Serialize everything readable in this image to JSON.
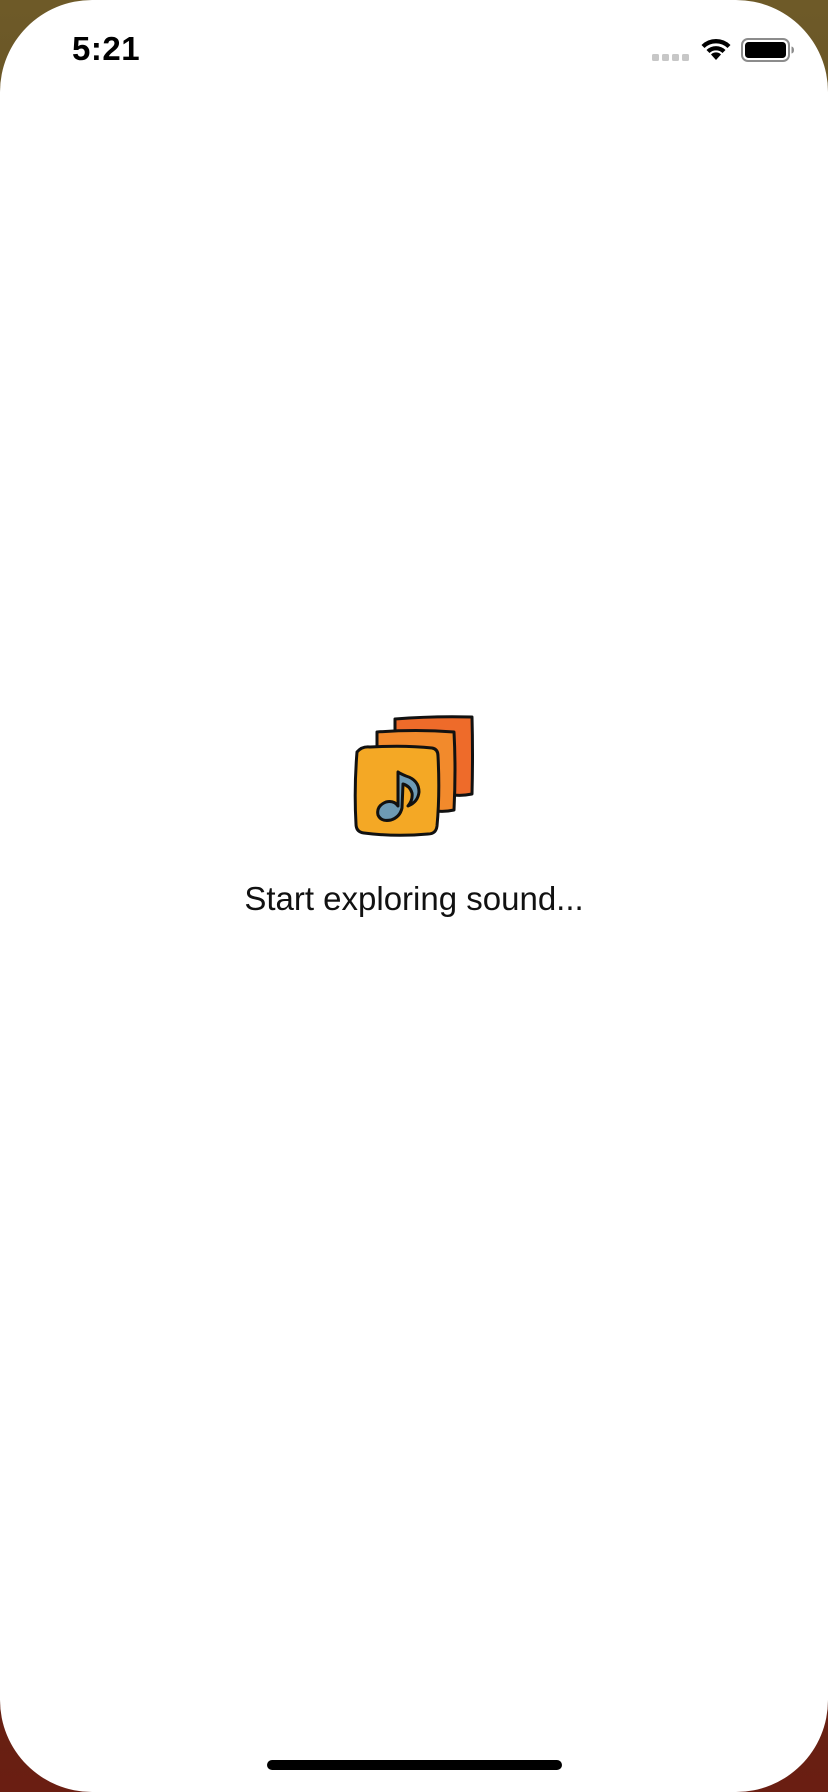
{
  "status_bar": {
    "time": "5:21",
    "icons": [
      "cellular-signal-icon",
      "wifi-icon",
      "battery-icon"
    ]
  },
  "empty_state": {
    "icon": "music-albums-icon",
    "message": "Start exploring sound..."
  },
  "colors": {
    "background": "#ffffff",
    "text": "#111111",
    "album_back": "#ee6b2a",
    "album_mid": "#f28a2c",
    "album_front": "#f4a825",
    "music_note": "#6e9bb5"
  }
}
